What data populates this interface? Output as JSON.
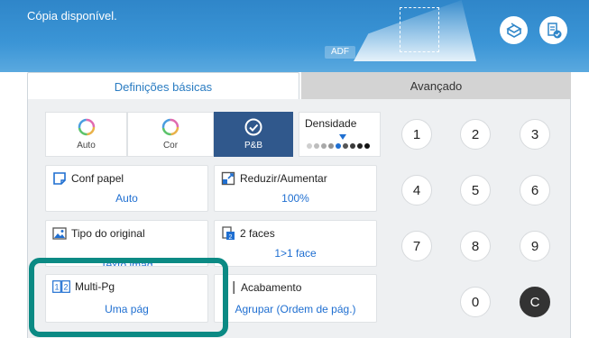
{
  "header": {
    "status": "Cópia disponível.",
    "adf_label": "ADF"
  },
  "tabs": [
    {
      "label": "Definições básicas",
      "active": true
    },
    {
      "label": "Avançado",
      "active": false
    }
  ],
  "color_mode": {
    "options": [
      {
        "label": "Auto",
        "icon": "color-ring-icon"
      },
      {
        "label": "Cor",
        "icon": "color-ring-icon"
      },
      {
        "label": "P&B",
        "icon": "checkmark-icon",
        "selected": true
      }
    ]
  },
  "density": {
    "title": "Densidade",
    "level": 5,
    "steps": 9
  },
  "settings": {
    "paper": {
      "title": "Conf papel",
      "value": "Auto",
      "icon": "paper-icon"
    },
    "zoom": {
      "title": "Reduzir/Aumentar",
      "value": "100%",
      "icon": "resize-icon"
    },
    "original_type": {
      "title": "Tipo do original",
      "value": "Texto imag",
      "icon": "image-icon"
    },
    "duplex": {
      "title": "2 faces",
      "value": "1>1 face",
      "icon": "two-sided-icon"
    },
    "multipage": {
      "title": "Multi-Pg",
      "value": "Uma pág",
      "icon": "multipage-icon"
    },
    "finishing": {
      "title": "Acabamento",
      "value": "Agrupar (Ordem de pág.)",
      "icon": "finishing-icon"
    }
  },
  "keypad": {
    "keys": [
      "1",
      "2",
      "3",
      "4",
      "5",
      "6",
      "7",
      "8",
      "9",
      "0"
    ],
    "clear": "C"
  },
  "colors": {
    "header_blue": "#2f86c9",
    "value_blue": "#1f6fd1",
    "selected_navy": "#30588c",
    "highlight_teal": "#0b8a84"
  }
}
